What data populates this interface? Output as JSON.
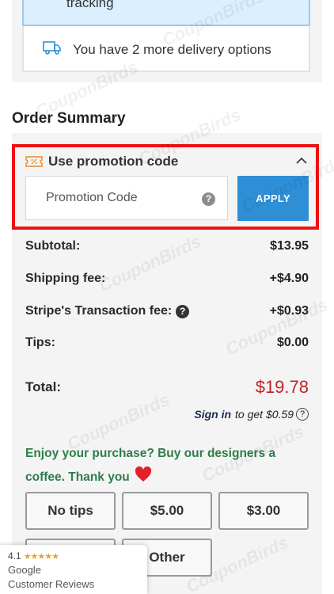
{
  "delivery": {
    "tracking_text": "tracking",
    "options_text": "You have 2 more delivery options"
  },
  "order_summary": {
    "title": "Order Summary",
    "promo": {
      "label": "Use promotion code",
      "placeholder": "Promotion Code",
      "help": "?",
      "apply_label": "APPLY"
    },
    "lines": [
      {
        "label": "Subtotal:",
        "value": "$13.95"
      },
      {
        "label": "Shipping fee:",
        "value": "+$4.90"
      },
      {
        "label": "Stripe's Transaction fee:",
        "value": "+$0.93"
      },
      {
        "label": "Tips:",
        "value": "$0.00"
      }
    ],
    "stripe_help": "?",
    "total": {
      "label": "Total:",
      "value": "$19.78"
    },
    "signin": {
      "link": "Sign in",
      "text": "to get $0.59",
      "help": "?"
    },
    "enjoy_text": "Enjoy your purchase? Buy our designers a coffee. Thank you",
    "tips": [
      "No tips",
      "$5.00",
      "$3.00",
      "Other"
    ]
  },
  "google_badge": {
    "rating": "4.1",
    "stars": "★★★★★",
    "brand": "Google",
    "caption": "Customer Reviews"
  },
  "watermark": "CouponBirds",
  "colors": {
    "accent_blue": "#2e8fd6",
    "highlight_red": "#ee1111",
    "total_red": "#c0222b",
    "green_text": "#2e7d4a"
  }
}
